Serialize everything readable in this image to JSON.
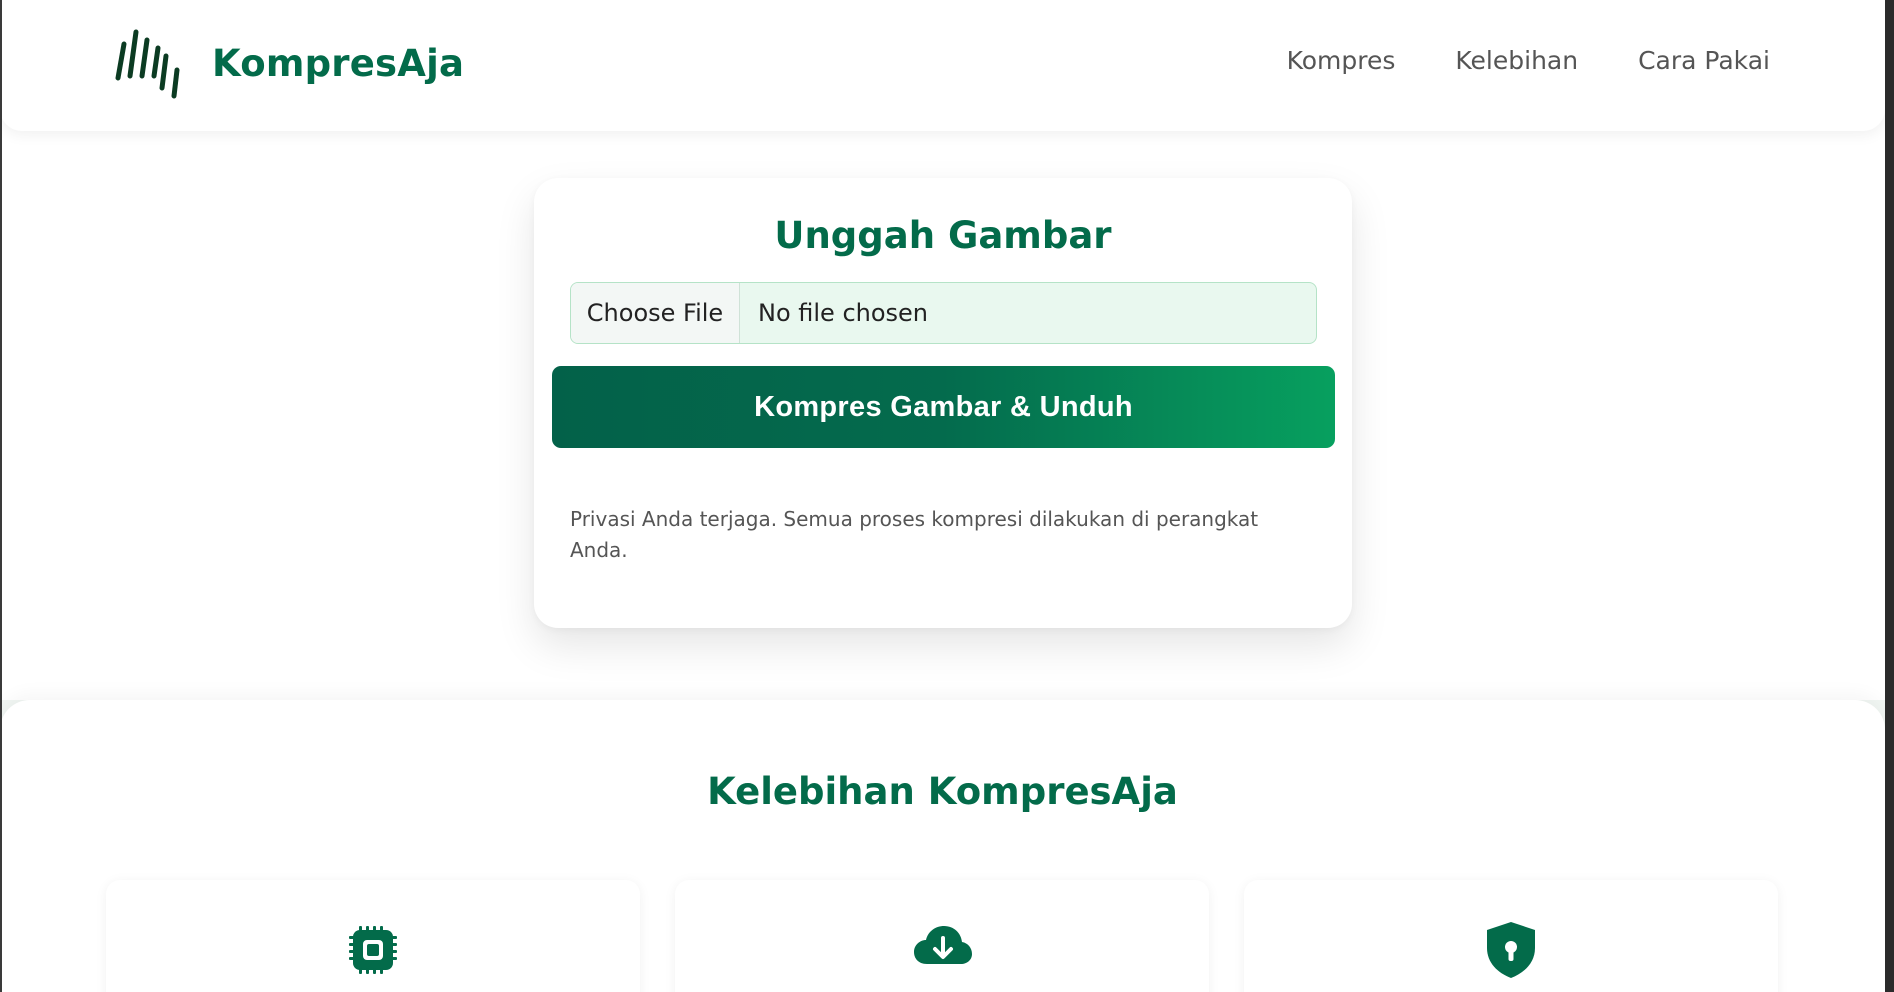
{
  "brand": {
    "name": "KompresAja",
    "logo_icon": "brand-bars-icon"
  },
  "nav": {
    "items": [
      "Kompres",
      "Kelebihan",
      "Cara Pakai"
    ]
  },
  "upload": {
    "title": "Unggah Gambar",
    "file_button_label": "Choose File",
    "file_status": "No file chosen",
    "submit_label": "Kompres Gambar & Unduh",
    "privacy_note": "Privasi Anda terjaga. Semua proses kompresi dilakukan di perangkat Anda."
  },
  "features": {
    "title": "Kelebihan KompresAja",
    "cards": [
      {
        "icon": "chip-icon"
      },
      {
        "icon": "cloud-download-icon"
      },
      {
        "icon": "shield-lock-icon"
      }
    ]
  },
  "colors": {
    "brand": "#036b4a",
    "accent": "#07a05f",
    "input_bg": "#e9f8ef"
  }
}
